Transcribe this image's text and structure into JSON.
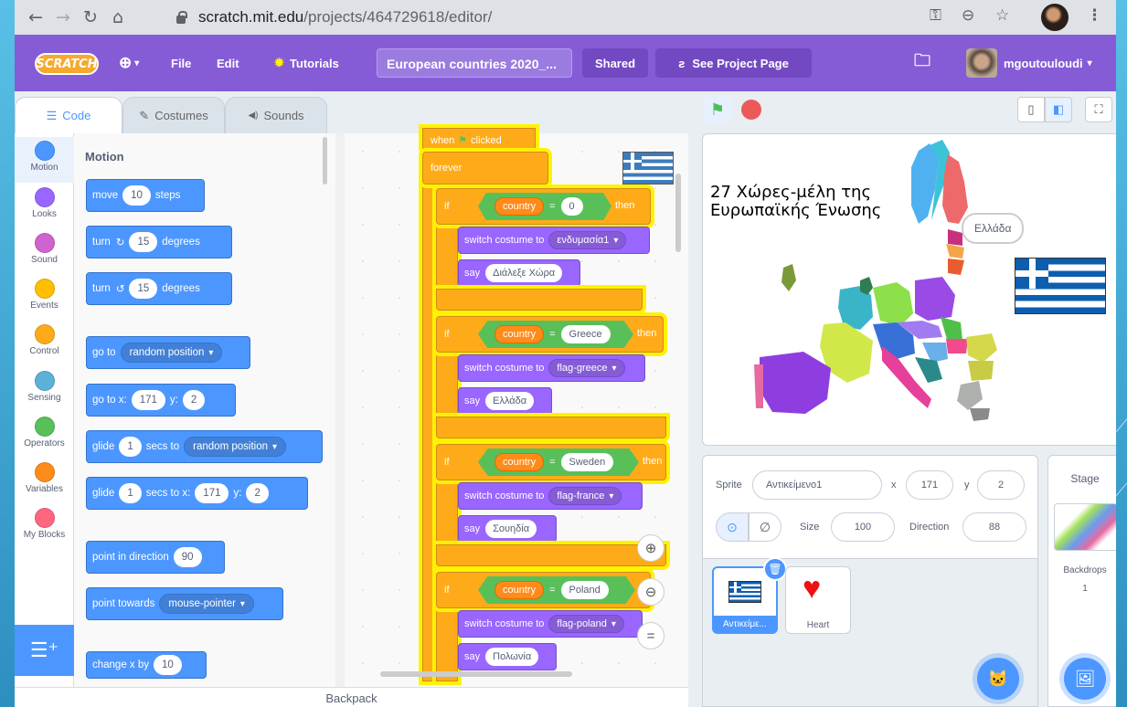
{
  "browser": {
    "url_domain": "scratch.mit.edu",
    "url_path": "/projects/464729618/editor/"
  },
  "menu": {
    "logo": "SCRATCH",
    "file": "File",
    "edit": "Edit",
    "tutorials": "Tutorials",
    "project_title": "European countries 2020_...",
    "shared": "Shared",
    "see_project": "See Project Page",
    "username": "mgoutouloudi"
  },
  "tabs": {
    "code": "Code",
    "costumes": "Costumes",
    "sounds": "Sounds"
  },
  "categories": [
    {
      "label": "Motion",
      "color": "#4c97ff"
    },
    {
      "label": "Looks",
      "color": "#9966ff"
    },
    {
      "label": "Sound",
      "color": "#cf63cf"
    },
    {
      "label": "Events",
      "color": "#ffbf00"
    },
    {
      "label": "Control",
      "color": "#ffab19"
    },
    {
      "label": "Sensing",
      "color": "#5cb1d6"
    },
    {
      "label": "Operators",
      "color": "#59c059"
    },
    {
      "label": "Variables",
      "color": "#ff8c1a"
    },
    {
      "label": "My Blocks",
      "color": "#ff6680"
    }
  ],
  "palette": {
    "heading": "Motion",
    "move": "move",
    "move_val": "10",
    "steps": "steps",
    "turn": "turn",
    "turn_r_val": "15",
    "degrees": "degrees",
    "turn_l_val": "15",
    "go_to": "go to",
    "random_position": "random position",
    "go_to_x": "go to x:",
    "x_val": "171",
    "y_lbl": "y:",
    "y_val": "2",
    "glide": "glide",
    "glide_secs": "1",
    "secs_to": "secs to",
    "secs_to_x": "secs to x:",
    "point_dir": "point in direction",
    "dir_val": "90",
    "point_towards": "point towards",
    "mouse_pointer": "mouse-pointer",
    "change_x": "change x by",
    "change_x_val": "10"
  },
  "script": {
    "when": "when",
    "clicked": "clicked",
    "forever": "forever",
    "if_blocks": [
      {
        "var": "country",
        "op": "=",
        "value": "0",
        "costume": "ενδυμασία1",
        "say": "Διάλεξε Χώρα"
      },
      {
        "var": "country",
        "op": "=",
        "value": "Greece",
        "costume": "flag-greece",
        "say": "Ελλάδα"
      },
      {
        "var": "country",
        "op": "=",
        "value": "Sweden",
        "costume": "flag-france",
        "say": "Σουηδία"
      },
      {
        "var": "country",
        "op": "=",
        "value": "Poland",
        "costume": "flag-poland",
        "say": "Πολωνία"
      }
    ],
    "if": "if",
    "then": "then",
    "switch": "switch costume to",
    "say": "say"
  },
  "backpack": "Backpack",
  "stage": {
    "title_line1": "27 Χώρες-μέλη της",
    "title_line2": "Ευρωπαϊκής Ένωσης",
    "bubble": "Ελλάδα"
  },
  "sprite_info": {
    "sprite_lbl": "Sprite",
    "sprite_name": "Αντικείμενο1",
    "x_lbl": "x",
    "x": "171",
    "y_lbl": "y",
    "y": "2",
    "size_lbl": "Size",
    "size": "100",
    "direction_lbl": "Direction",
    "direction": "88"
  },
  "sprites": [
    {
      "name": "Αντικείμε...",
      "selected": true
    },
    {
      "name": "Heart",
      "selected": false
    }
  ],
  "stage_panel": {
    "title": "Stage",
    "backdrops_lbl": "Backdrops",
    "backdrops_count": "1"
  }
}
